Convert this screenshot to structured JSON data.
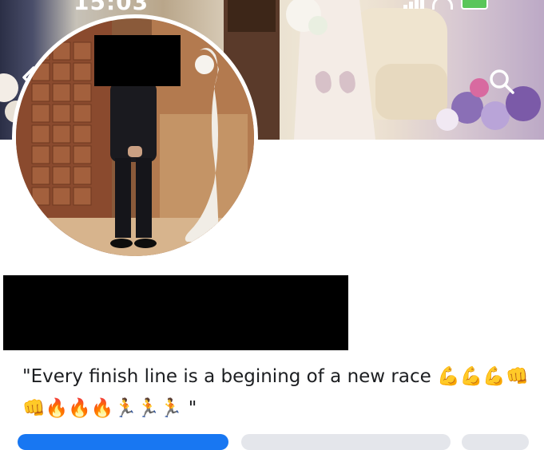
{
  "status_bar": {
    "time": "15:03"
  },
  "profile": {
    "bio": "\"Every finish line is a begining of a new race 💪💪💪👊👊🔥🔥🔥🏃🏃🏃 \""
  },
  "icons": {
    "back": "chevron-left-icon",
    "search": "search-icon",
    "signal": "signal-icon",
    "wifi": "wifi-icon",
    "battery": "battery-charging-icon"
  },
  "colors": {
    "primary_button": "#1877f2",
    "secondary_button": "#e4e6eb",
    "text": "#1c1e21"
  }
}
